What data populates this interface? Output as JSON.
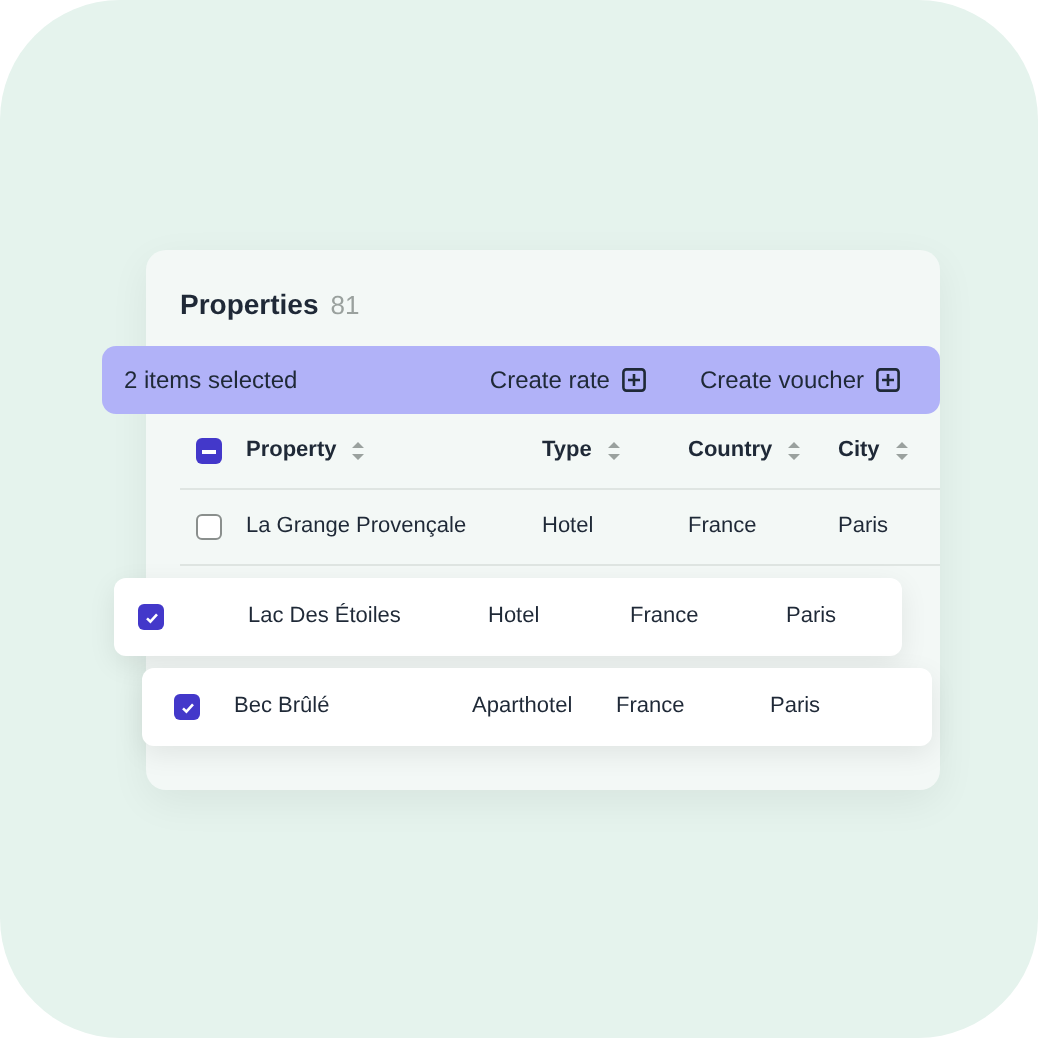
{
  "title": "Properties",
  "count": "81",
  "selection_bar": {
    "text": "2 items selected",
    "actions": [
      "Create rate",
      "Create voucher"
    ]
  },
  "select_all": {
    "indeterminate": true
  },
  "columns": [
    "Property",
    "Type",
    "Country",
    "City"
  ],
  "rows": [
    {
      "kind": "inline",
      "selected": false,
      "cells": [
        "La Grange Provençale",
        "Hotel",
        "France",
        "Paris"
      ]
    },
    {
      "kind": "lifted",
      "selected": true,
      "cells": [
        "Lac Des Étoiles",
        "Hotel",
        "France",
        "Paris"
      ]
    },
    {
      "kind": "lifted",
      "selected": true,
      "cells": [
        "Bec Brûlé",
        "Aparthotel",
        "France",
        "Paris"
      ]
    }
  ]
}
